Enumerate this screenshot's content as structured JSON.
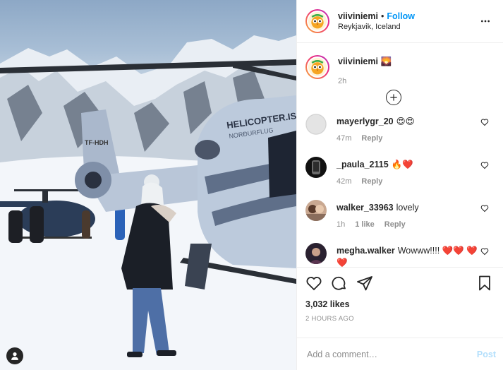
{
  "post": {
    "username": "viiviniemi",
    "follow_label": "Follow",
    "separator": "•",
    "location": "Reykjavik, Iceland",
    "caption_emoji": "🌄",
    "caption_time": "2h",
    "likes": "3,032 likes",
    "posted": "2 HOURS AGO"
  },
  "photo": {
    "helicopter_text": "HELICOPTER.IS",
    "helicopter_text2": "NORÐURFLUG",
    "tail_code": "TF-HDH"
  },
  "comments": [
    {
      "username": "mayerlygr_20",
      "text": "😍😍",
      "time": "47m",
      "likes": "",
      "reply": "Reply",
      "avatar": "blank"
    },
    {
      "username": "_paula_2115",
      "text": "🔥❤️",
      "time": "42m",
      "likes": "",
      "reply": "Reply",
      "avatar": "dark"
    },
    {
      "username": "walker_33963",
      "text": "lovely",
      "time": "1h",
      "likes": "1 like",
      "reply": "Reply",
      "avatar": "group"
    },
    {
      "username": "megha.walker",
      "text": "Wowww!!!! ❤️❤️ ❤️❤️",
      "time": "",
      "likes": "",
      "reply": "",
      "avatar": "portrait"
    }
  ],
  "composer": {
    "placeholder": "Add a comment…",
    "post_label": "Post"
  },
  "colors": {
    "accent": "#0095f6",
    "post_disabled": "#b2dffc",
    "muted": "#8e8e8e"
  }
}
